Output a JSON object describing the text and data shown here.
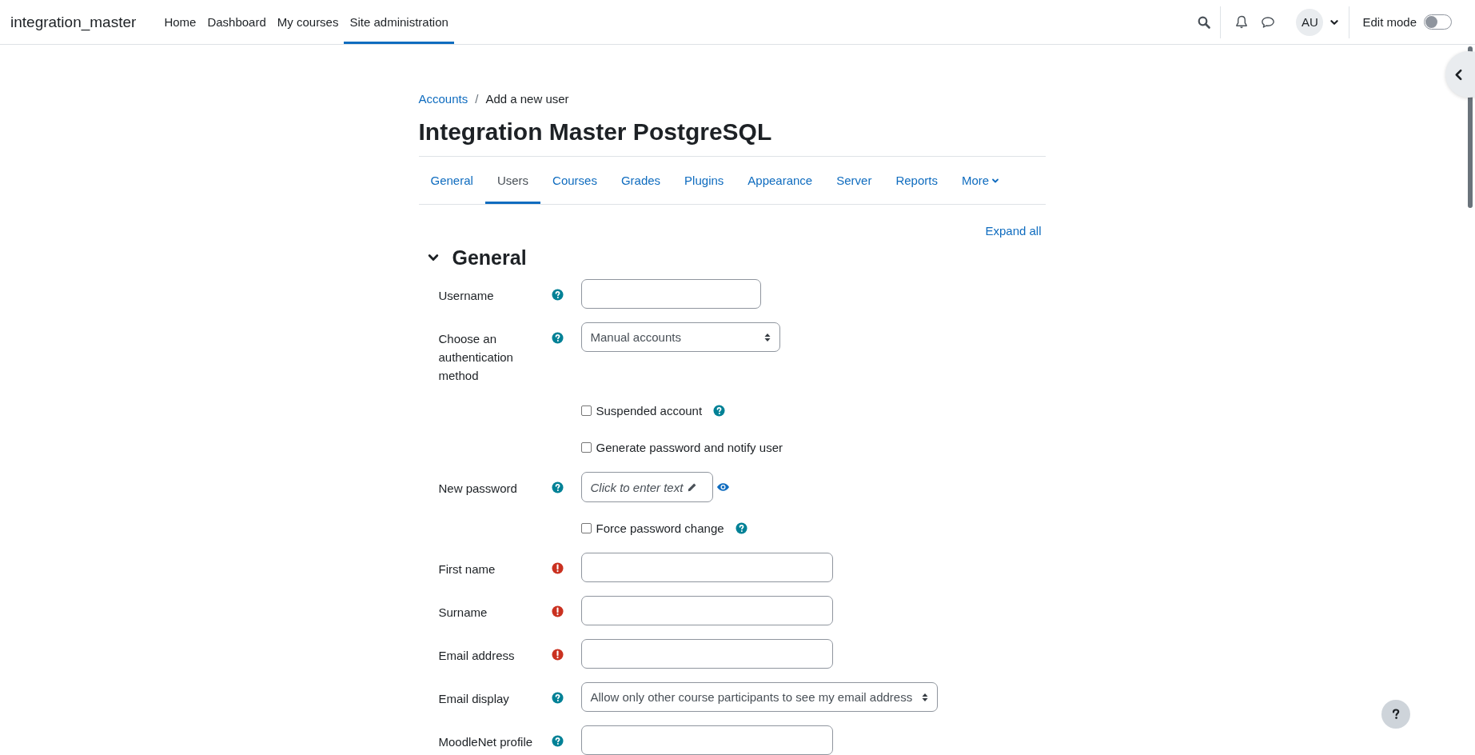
{
  "navbar": {
    "brand": "integration_master",
    "links": [
      {
        "label": "Home",
        "selected": false
      },
      {
        "label": "Dashboard",
        "selected": false
      },
      {
        "label": "My courses",
        "selected": false
      },
      {
        "label": "Site administration",
        "selected": true
      }
    ],
    "user_initials": "AU",
    "edit_mode": {
      "label": "Edit mode",
      "on": false
    }
  },
  "breadcrumb_separator": "/",
  "breadcrumb": [
    {
      "label": "Accounts",
      "kind": "link"
    },
    {
      "label": "Add a new user",
      "kind": "current"
    }
  ],
  "page_title": "Integration Master PostgreSQL",
  "tabs": [
    {
      "label": "General",
      "selected": false,
      "kind": "link"
    },
    {
      "label": "Users",
      "selected": true,
      "kind": "link"
    },
    {
      "label": "Courses",
      "selected": false,
      "kind": "link"
    },
    {
      "label": "Grades",
      "selected": false,
      "kind": "link"
    },
    {
      "label": "Plugins",
      "selected": false,
      "kind": "link"
    },
    {
      "label": "Appearance",
      "selected": false,
      "kind": "link"
    },
    {
      "label": "Server",
      "selected": false,
      "kind": "link"
    },
    {
      "label": "Reports",
      "selected": false,
      "kind": "link"
    },
    {
      "label": "More",
      "selected": false,
      "kind": "menu"
    }
  ],
  "expand_all": "Expand all",
  "section": {
    "title": "General",
    "expanded": true,
    "fields": [
      {
        "kind": "short-text",
        "label": "Username",
        "help": true,
        "required": false
      },
      {
        "kind": "select",
        "label": "Choose an authentication method",
        "help": true,
        "required": false,
        "value": "Manual accounts"
      },
      {
        "kind": "checkbox",
        "label": "Suspended account",
        "checked": false,
        "help": true
      },
      {
        "kind": "checkbox",
        "label": "Generate password and notify user",
        "checked": false,
        "help": false
      },
      {
        "kind": "inline-edit",
        "label": "New password",
        "help": true,
        "required": false,
        "prompt": "Click to enter text"
      },
      {
        "kind": "checkbox",
        "label": "Force password change",
        "checked": false,
        "help": true
      },
      {
        "kind": "text",
        "label": "First name",
        "required": true
      },
      {
        "kind": "text",
        "label": "Surname",
        "required": true
      },
      {
        "kind": "text",
        "label": "Email address",
        "required": true
      },
      {
        "kind": "select",
        "label": "Email display",
        "help": true,
        "required": false,
        "value": "Allow only other course participants to see my email address"
      },
      {
        "kind": "text",
        "label": "MoodleNet profile",
        "help": true,
        "required": false
      }
    ]
  }
}
